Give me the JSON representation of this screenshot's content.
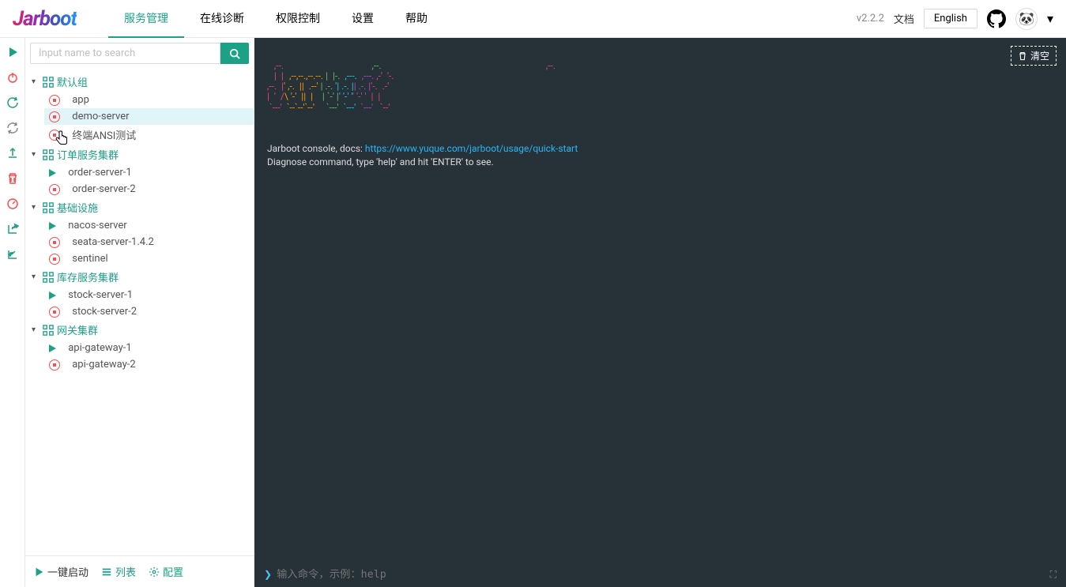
{
  "header": {
    "logo_text": "Jarboot",
    "nav": [
      "服务管理",
      "在线诊断",
      "权限控制",
      "设置",
      "帮助"
    ],
    "active_nav": 0,
    "version": "v2.2.2",
    "doc_label": "文档",
    "lang_btn": "English"
  },
  "search": {
    "placeholder": "Input name to search"
  },
  "tree": [
    {
      "name": "默认组",
      "children": [
        {
          "name": "app",
          "status": "stopped"
        },
        {
          "name": "demo-server",
          "status": "stopped",
          "selected": true
        },
        {
          "name": "终端ANSI测试",
          "status": "stopped"
        }
      ]
    },
    {
      "name": "订单服务集群",
      "children": [
        {
          "name": "order-server-1",
          "status": "running"
        },
        {
          "name": "order-server-2",
          "status": "stopped"
        }
      ]
    },
    {
      "name": "基础设施",
      "children": [
        {
          "name": "nacos-server",
          "status": "running"
        },
        {
          "name": "seata-server-1.4.2",
          "status": "stopped"
        },
        {
          "name": "sentinel",
          "status": "stopped"
        }
      ]
    },
    {
      "name": "库存服务集群",
      "children": [
        {
          "name": "stock-server-1",
          "status": "running"
        },
        {
          "name": "stock-server-2",
          "status": "stopped"
        }
      ]
    },
    {
      "name": "网关集群",
      "children": [
        {
          "name": "api-gateway-1",
          "status": "running"
        },
        {
          "name": "api-gateway-2",
          "status": "stopped"
        }
      ]
    }
  ],
  "bottom_bar": {
    "start_all": "一键启动",
    "list": "列表",
    "config": "配置"
  },
  "console": {
    "clear_btn": "清空",
    "intro_text": "Jarboot console, docs: ",
    "docs_url": "https://www.yuque.com/jarboot/usage/quick-start",
    "diag_text": "Diagnose command, type 'help' and hit 'ENTER' to see.",
    "cmd_placeholder": "输入命令，示例：help"
  }
}
